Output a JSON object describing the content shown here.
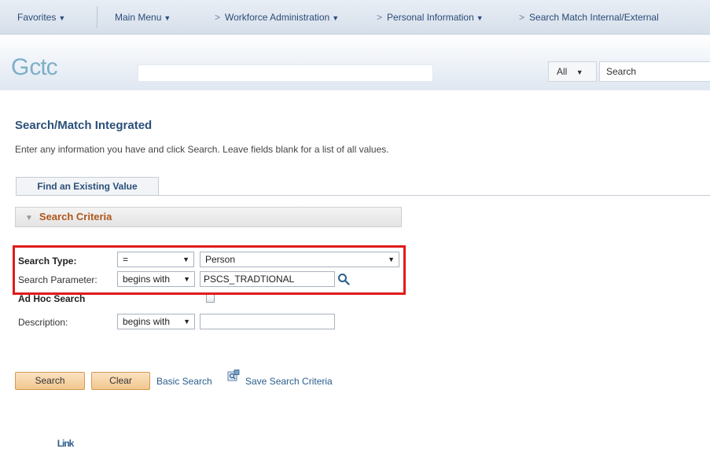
{
  "nav": {
    "favorites": "Favorites",
    "main_menu": "Main Menu",
    "breadcrumbs": [
      "Workforce Administration",
      "Personal Information",
      "Search Match Internal/External"
    ]
  },
  "header": {
    "logo": {
      "mark": "G",
      "ctc": "ctc",
      "link": "Link"
    },
    "search_scope": "All",
    "search_placeholder": "Search"
  },
  "page": {
    "title": "Search/Match Integrated",
    "instructions": "Enter any information you have and click Search. Leave fields blank for a list of all values.",
    "tab_label": "Find an Existing Value",
    "section_label": "Search Criteria"
  },
  "form": {
    "search_type": {
      "label": "Search Type:",
      "operator": "=",
      "value": "Person"
    },
    "search_parameter": {
      "label": "Search Parameter:",
      "operator": "begins with",
      "value": "PSCS_TRADTIONAL"
    },
    "ad_hoc_search": {
      "label": "Ad Hoc Search",
      "checked": false
    },
    "description": {
      "label": "Description:",
      "operator": "begins with",
      "value": ""
    }
  },
  "actions": {
    "search_button": "Search",
    "clear_button": "Clear",
    "basic_search_link": "Basic Search",
    "save_search_link": "Save Search Criteria"
  },
  "colors": {
    "highlight_border": "#e01b1b",
    "button_fill": "#f1c68d",
    "title_blue": "#2b4f79",
    "section_orange": "#b0571a"
  },
  "icons": [
    "chevron-down-icon",
    "breadcrumb-arrow-icon",
    "lookup-magnifier-icon",
    "save-search-icon",
    "collapse-triangle-icon"
  ]
}
